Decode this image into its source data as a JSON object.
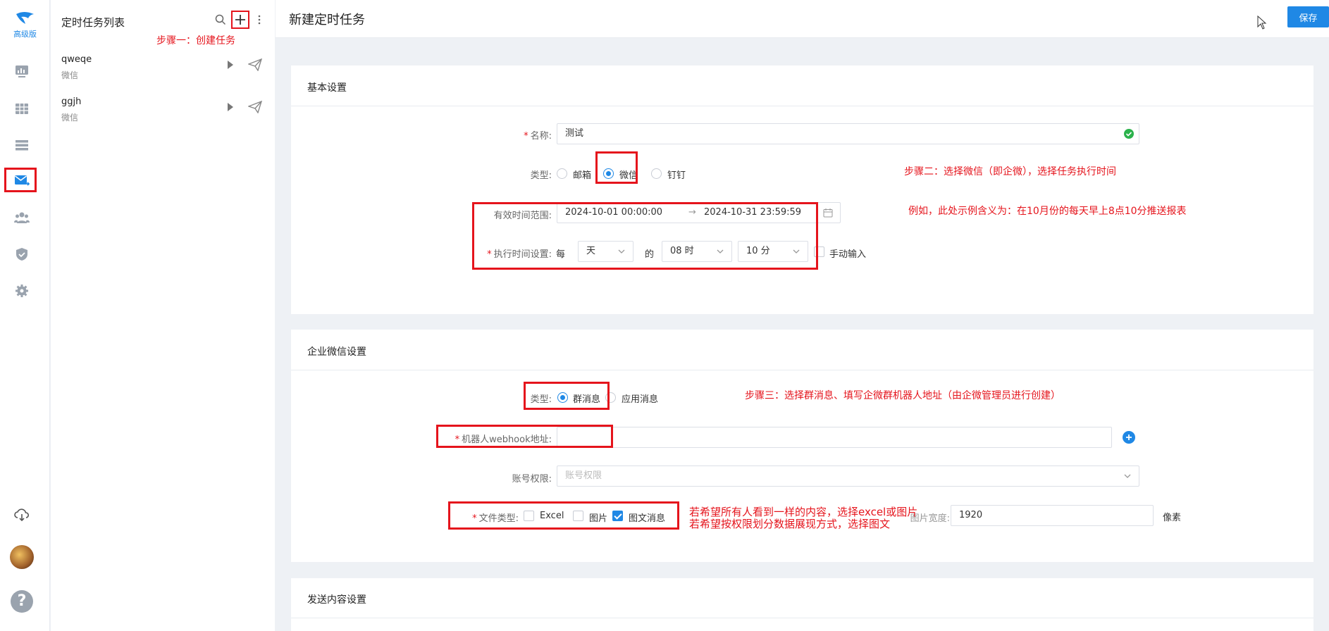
{
  "logo": {
    "text": "高级版"
  },
  "rail": {
    "icons": [
      "monitor-icon",
      "table-icon",
      "list-icon",
      "mail-task-icon",
      "users-icon",
      "shield-icon",
      "gear-icon",
      "cloud-download-icon",
      "avatar",
      "help-icon"
    ],
    "help_glyph": "?"
  },
  "panel": {
    "title": "定时任务列表",
    "step1": "步骤一：创建任务",
    "tasks": [
      {
        "name": "qweqe",
        "type": "微信"
      },
      {
        "name": "ggjh",
        "type": "微信"
      }
    ]
  },
  "header": {
    "title": "新建定时任务",
    "save_label": "保存"
  },
  "basic": {
    "title": "基本设置",
    "name_label": "名称:",
    "name_value": "测试",
    "type_label": "类型:",
    "type_options": [
      "邮箱",
      "微信",
      "钉钉"
    ],
    "type_selected": "微信",
    "range_label": "有效时间范围:",
    "range_start": "2024-10-01 00:00:00",
    "range_sep": "→",
    "range_end": "2024-10-31 23:59:59",
    "exec_label": "执行时间设置:",
    "exec_every": "每",
    "exec_unit": "天",
    "exec_of": "的",
    "exec_hour": "08 时",
    "exec_minute": "10 分",
    "manual_input": "手动输入",
    "step2": "步骤二：选择微信（即企微），选择任务执行时间",
    "example": "例如，此处示例含义为：在10月份的每天早上8点10分推送报表"
  },
  "wecom": {
    "title": "企业微信设置",
    "type_label": "类型:",
    "type_options": [
      "群消息",
      "应用消息"
    ],
    "type_selected": "群消息",
    "step3": "步骤三：选择群消息、填写企微群机器人地址（由企微管理员进行创建）",
    "webhook_label": "机器人webhook地址:",
    "webhook_value": "",
    "account_label": "账号权限:",
    "account_placeholder": "账号权限",
    "file_type_label": "文件类型:",
    "file_types": [
      {
        "label": "Excel",
        "checked": false
      },
      {
        "label": "图片",
        "checked": false
      },
      {
        "label": "图文消息",
        "checked": true
      }
    ],
    "width_label": "图片宽度:",
    "width_value": "1920",
    "width_unit": "像素",
    "note_line1": "若希望所有人看到一样的内容，选择excel或图片",
    "note_line2": "若希望按权限划分数据展现方式，选择图文"
  },
  "send": {
    "title": "发送内容设置"
  },
  "colors": {
    "accent": "#1f88e5",
    "annotation": "#e5141c",
    "valid": "#2bb24c"
  }
}
